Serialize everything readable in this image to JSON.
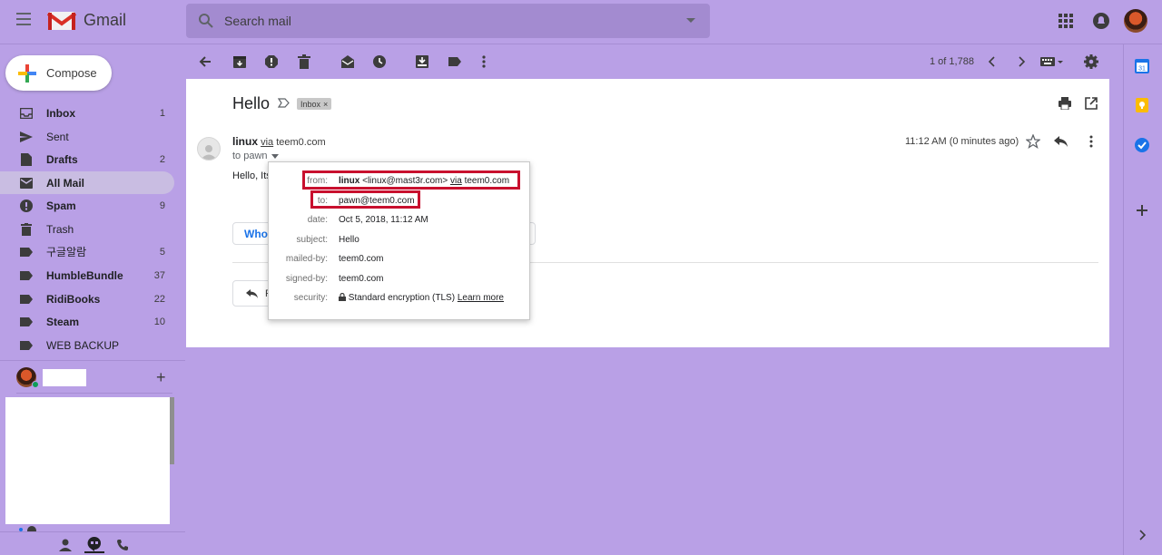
{
  "header": {
    "logo_text": "Gmail",
    "search_placeholder": "Search mail"
  },
  "compose_label": "Compose",
  "sidebar": {
    "items": [
      {
        "label": "Inbox",
        "count": "1",
        "bold": true,
        "icon": "inbox-icon"
      },
      {
        "label": "Sent",
        "count": "",
        "bold": false,
        "icon": "send-icon"
      },
      {
        "label": "Drafts",
        "count": "2",
        "bold": true,
        "icon": "draft-icon"
      },
      {
        "label": "All Mail",
        "count": "",
        "bold": true,
        "icon": "all-mail-icon",
        "active": true
      },
      {
        "label": "Spam",
        "count": "9",
        "bold": true,
        "icon": "spam-icon"
      },
      {
        "label": "Trash",
        "count": "",
        "bold": false,
        "icon": "trash-icon"
      },
      {
        "label": "구글알람",
        "count": "5",
        "bold": false,
        "icon": "label-icon"
      },
      {
        "label": "HumbleBundle",
        "count": "37",
        "bold": true,
        "icon": "label-icon"
      },
      {
        "label": "RidiBooks",
        "count": "22",
        "bold": true,
        "icon": "label-icon"
      },
      {
        "label": "Steam",
        "count": "10",
        "bold": true,
        "icon": "label-icon"
      },
      {
        "label": "WEB BACKUP",
        "count": "",
        "bold": false,
        "icon": "label-icon"
      }
    ]
  },
  "toolbar": {
    "pager": "1 of 1,788"
  },
  "email": {
    "subject": "Hello",
    "label_chip": "Inbox",
    "sender_name": "linux",
    "via_word": "via",
    "via_domain": "teem0.com",
    "to_line": "to pawn",
    "time": "11:12 AM (0 minutes ago)",
    "body_preview": "Hello, Its",
    "smart_reply": "Who",
    "reply_initial": "R"
  },
  "details": {
    "from_key": "from:",
    "from_name": "linux",
    "from_addr": "<linux@mast3r.com>",
    "from_via": "via",
    "from_domain": "teem0.com",
    "to_key": "to:",
    "to_value": "pawn@teem0.com",
    "date_key": "date:",
    "date_value": "Oct 5, 2018, 11:12 AM",
    "subject_key": "subject:",
    "subject_value": "Hello",
    "mailed_key": "mailed-by:",
    "mailed_value": "teem0.com",
    "signed_key": "signed-by:",
    "signed_value": "teem0.com",
    "security_key": "security:",
    "security_value": "Standard encryption (TLS)",
    "learn_more": "Learn more"
  },
  "colors": {
    "background": "#b9a0e6",
    "highlight_box": "#c8102e",
    "link_blue": "#1a73e8"
  }
}
